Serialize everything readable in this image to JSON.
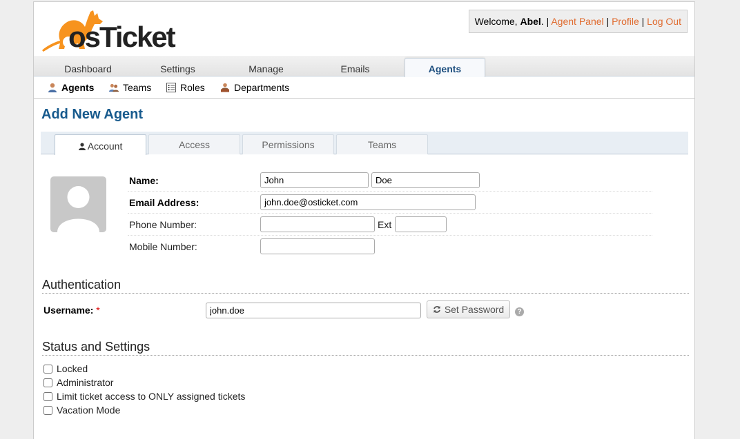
{
  "brand": {
    "logo_text": "osTicket"
  },
  "header": {
    "welcome_prefix": "Welcome,",
    "user_name": "Abel",
    "user_suffix": ".",
    "sep": "|",
    "links": [
      "Agent Panel",
      "Profile",
      "Log Out"
    ]
  },
  "nav": {
    "items": [
      "Dashboard",
      "Settings",
      "Manage",
      "Emails",
      "Agents"
    ],
    "active": "Agents"
  },
  "subnav": {
    "items": [
      "Agents",
      "Teams",
      "Roles",
      "Departments"
    ],
    "active": "Agents"
  },
  "page": {
    "title": "Add New Agent"
  },
  "tabs": {
    "items": [
      "Account",
      "Access",
      "Permissions",
      "Teams"
    ],
    "active": "Account"
  },
  "form": {
    "name_label": "Name:",
    "first_name": "John",
    "last_name": "Doe",
    "email_label": "Email Address:",
    "email": "john.doe@osticket.com",
    "phone_label": "Phone Number:",
    "phone": "",
    "ext_label": "Ext",
    "ext": "",
    "mobile_label": "Mobile Number:",
    "mobile": ""
  },
  "auth": {
    "heading": "Authentication",
    "username_label": "Username:",
    "required_mark": "*",
    "username": "john.doe",
    "set_password_label": "Set Password",
    "help_glyph": "?"
  },
  "status": {
    "heading": "Status and Settings",
    "checkboxes": [
      {
        "label": "Locked",
        "checked": false
      },
      {
        "label": "Administrator",
        "checked": false
      },
      {
        "label": "Limit ticket access to ONLY assigned tickets",
        "checked": false
      },
      {
        "label": "Vacation Mode",
        "checked": false
      }
    ]
  },
  "colors": {
    "accent": "#e06b2f",
    "title": "#175a8d",
    "logo_orange": "#f7931e"
  }
}
